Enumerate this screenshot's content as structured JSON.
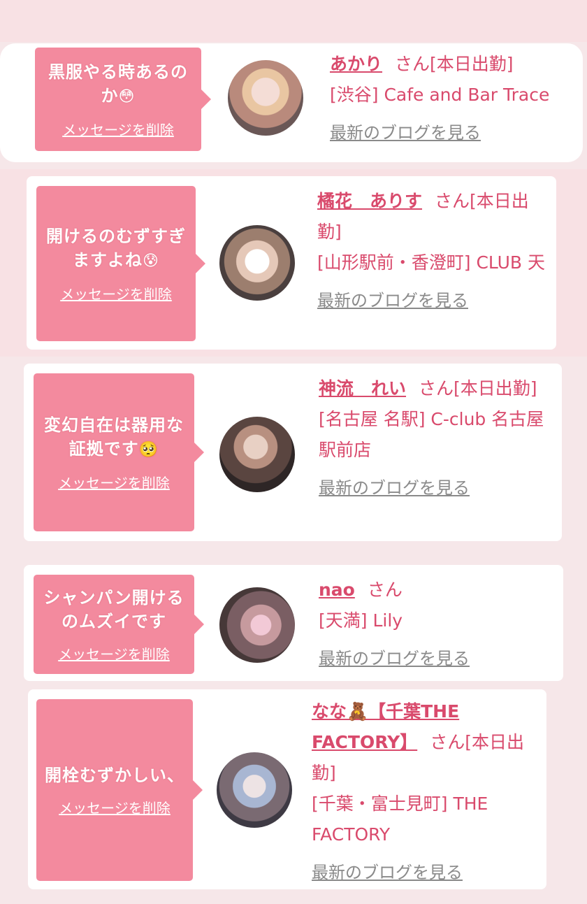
{
  "cards": [
    {
      "message": "黒服やる時あるのか",
      "emoji": "😳",
      "delete_label": "メッセージを削除",
      "name": "あかり",
      "suffix": "さん[本日出勤]",
      "store": "[渋谷] Cafe and Bar Trace",
      "blog_label": "最新のブログを見る"
    },
    {
      "message": "開けるのむずすぎますよね",
      "emoji": "😰",
      "delete_label": "メッセージを削除",
      "name": "橘花　ありす",
      "suffix": "さん[本日出勤]",
      "store": "[山形駅前・香澄町] CLUB 天",
      "blog_label": "最新のブログを見る"
    },
    {
      "message": "変幻自在は器用な証拠です",
      "emoji": "🥺",
      "delete_label": "メッセージを削除",
      "name": "神流　れい",
      "suffix": "さん[本日出勤]",
      "store": "[名古屋 名駅] C-club 名古屋駅前店",
      "blog_label": "最新のブログを見る"
    },
    {
      "message": "シャンパン開けるのムズイです",
      "emoji": "",
      "delete_label": "メッセージを削除",
      "name": "nao",
      "suffix": "さん",
      "store": "[天満] Lily",
      "blog_label": "最新のブログを見る"
    },
    {
      "message": "開栓むずかしい、",
      "emoji": "",
      "delete_label": "メッセージを削除",
      "name": "なな🧸【千葉THE FACTORY】",
      "suffix": "さん[本日出勤]",
      "store": "[千葉・富士見町] THE FACTORY",
      "blog_label": "最新のブログを見る"
    }
  ],
  "colors": {
    "accent": "#d94a6c",
    "bubble": "#f38a9e",
    "background": "#f6e7e9",
    "link_gray": "#8a8a8a"
  },
  "icons": [
    "avatar"
  ]
}
